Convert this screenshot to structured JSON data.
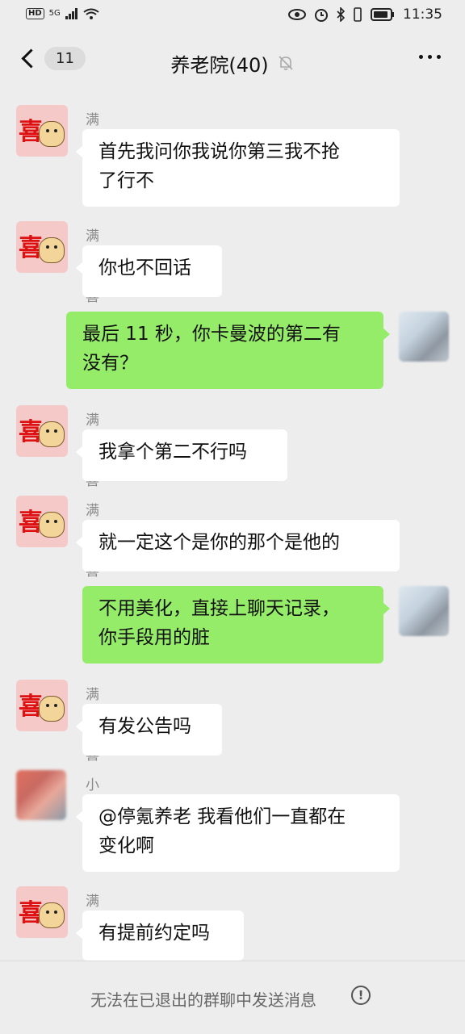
{
  "status_bar": {
    "network": "HD",
    "signal": "5G",
    "time": "11:35"
  },
  "header": {
    "unread_count": "11",
    "title": "养老院(40)"
  },
  "messages": [
    {
      "sender": "满心欢喜",
      "text_lines": [
        "首先我问你我说你第三我不抢",
        "了行不"
      ]
    },
    {
      "sender": "满心欢喜",
      "text_lines": [
        "你也不回话"
      ]
    },
    {
      "sender": "",
      "text_lines": [
        "最后 11 秒，你卡曼波的第二有",
        "没有？"
      ]
    },
    {
      "sender": "满心欢喜",
      "text_lines": [
        "我拿个第二不行吗"
      ]
    },
    {
      "sender": "满心欢喜",
      "text_lines": [
        "就一定这个是你的那个是他的"
      ]
    },
    {
      "sender": "",
      "text_lines": [
        "不用美化，直接上聊天记录，",
        "你手段用的脏"
      ]
    },
    {
      "sender": "满心欢喜",
      "text_lines": [
        "有发公告吗"
      ]
    },
    {
      "sender": "小老头",
      "text_lines": [
        "@停氪养老  我看他们一直都在",
        "变化啊"
      ]
    },
    {
      "sender": "满心欢喜",
      "text_lines": [
        "有提前约定吗"
      ]
    }
  ],
  "avatar_glyph": "喜",
  "footer": {
    "notice": "无法在已退出的群聊中发送消息",
    "info_glyph": "!"
  }
}
